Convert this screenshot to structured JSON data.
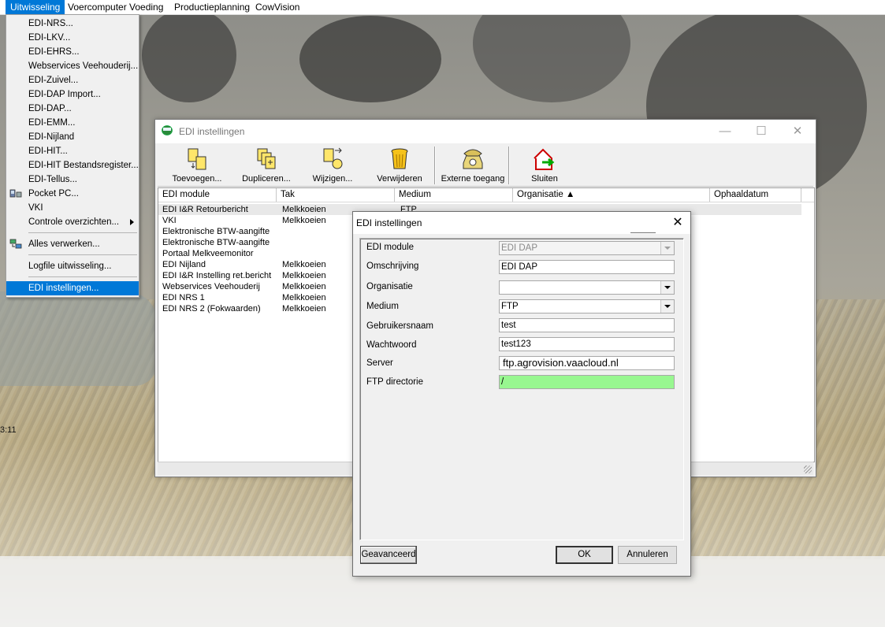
{
  "menubar": {
    "items": [
      {
        "label": "Uitwisseling",
        "accel": "U",
        "active": true
      },
      {
        "label": "Voercomputer",
        "accel": "",
        "active": false
      },
      {
        "label": "Voeding",
        "accel": "V",
        "active": false
      },
      {
        "label": "Productieplanning",
        "accel": "P",
        "active": false
      },
      {
        "label": "CowVision",
        "accel": "C",
        "active": false
      }
    ]
  },
  "menu_uitwisseling": {
    "items": [
      "EDI-NRS...",
      "EDI-LKV...",
      "EDI-EHRS...",
      "Webservices Veehouderij...",
      "EDI-Zuivel...",
      "EDI-DAP Import...",
      "EDI-DAP...",
      "EDI-EMM...",
      "EDI-Nijland",
      "EDI-HIT...",
      "EDI-HIT Bestandsregister...",
      "EDI-Tellus...",
      "Pocket PC...",
      "VKI",
      "Controle overzichten...",
      "Alles verwerken...",
      "Logfile uitwisseling...",
      "EDI instellingen..."
    ]
  },
  "clock_fragment": "3:11",
  "main_window": {
    "title": "EDI instellingen",
    "controls": {
      "minimize": "—",
      "maximize": "☐",
      "close": "✕"
    },
    "toolbar": {
      "buttons": [
        {
          "label": "Toevoegen...",
          "icon": "add-document-icon"
        },
        {
          "label": "Dupliceren...",
          "icon": "duplicate-icon"
        },
        {
          "label": "Wijzigen...",
          "icon": "edit-icon"
        },
        {
          "label": "Verwijderen",
          "icon": "trash-bin-icon"
        },
        {
          "label": "Externe toegang",
          "icon": "telephone-icon"
        },
        {
          "label": "Sluiten",
          "icon": "exit-house-icon"
        }
      ]
    },
    "list": {
      "columns": [
        "EDI module",
        "Tak",
        "Medium",
        "Organisatie ▲",
        "Ophaaldatum"
      ],
      "rows": [
        {
          "module": "EDI I&R Retourbericht",
          "tak": "Melkkoeien",
          "medium": "FTP"
        },
        {
          "module": "VKI",
          "tak": "Melkkoeien",
          "medium": ""
        },
        {
          "module": "Elektronische BTW-aangifte",
          "tak": "",
          "medium": ""
        },
        {
          "module": "Elektronische BTW-aangifte",
          "tak": "",
          "medium": ""
        },
        {
          "module": "Portaal Melkveemonitor",
          "tak": "",
          "medium": ""
        },
        {
          "module": "EDI Nijland",
          "tak": "Melkkoeien",
          "medium": ""
        },
        {
          "module": "EDI I&R Instelling ret.bericht",
          "tak": "Melkkoeien",
          "medium": ""
        },
        {
          "module": "Webservices Veehouderij",
          "tak": "Melkkoeien",
          "medium": ""
        },
        {
          "module": "EDI NRS 1",
          "tak": "Melkkoeien",
          "medium": ""
        },
        {
          "module": "EDI NRS 2 (Fokwaarden)",
          "tak": "Melkkoeien",
          "medium": ""
        }
      ]
    }
  },
  "dialog": {
    "title": "EDI instellingen",
    "close": "✕",
    "fields": [
      {
        "label": "EDI module",
        "value": "EDI DAP"
      },
      {
        "label": "Omschrijving",
        "value": "EDI DAP"
      },
      {
        "label": "Organisatie",
        "value": ""
      },
      {
        "label": "Medium",
        "value": "FTP"
      },
      {
        "label": "Gebruikersnaam",
        "value": "test"
      },
      {
        "label": "Wachtwoord",
        "value": "test123"
      },
      {
        "label": "Server",
        "value": "ftp.agrovision.vaacloud.nl"
      },
      {
        "label": "FTP directorie",
        "value": "/"
      }
    ],
    "buttons": {
      "advanced": "Geavanceerd",
      "ok": "OK",
      "cancel": "Annuleren"
    }
  }
}
